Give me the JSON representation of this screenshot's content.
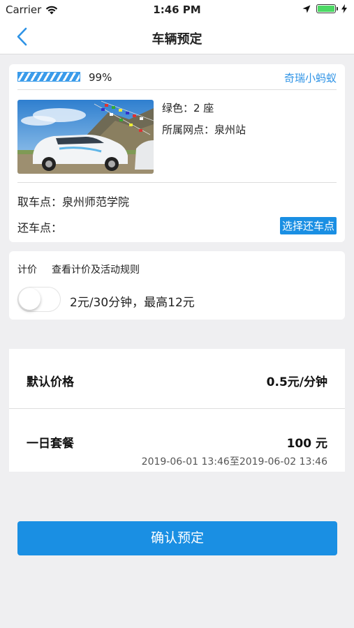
{
  "status_bar": {
    "carrier": "Carrier",
    "time": "1:46 PM"
  },
  "nav": {
    "title": "车辆预定",
    "back_icon": "chevron-left-icon"
  },
  "vehicle": {
    "battery_percent": 99,
    "battery_label": "99%",
    "model": "奇瑞小蚂蚁",
    "color_seats": "绿色：2 座",
    "station": "所属网点：泉州站",
    "pickup": "取车点：泉州师范学院",
    "return_label": "还车点：",
    "return_button": "选择还车点"
  },
  "pricing": {
    "title": "计价",
    "rules_link": "查看计价及活动规则",
    "toggle_on": false,
    "toggle_label": "2元/30分钟，最高12元"
  },
  "packages": [
    {
      "name": "默认价格",
      "price": "0.5元/分钟"
    },
    {
      "name": "一日套餐",
      "price": "100 元",
      "time": "2019-06-01 13:46至2019-06-02 13:46"
    }
  ],
  "confirm_button": "确认预定",
  "colors": {
    "accent": "#1a8fe3",
    "background": "#efeff1",
    "battery_green": "#4cd964"
  }
}
